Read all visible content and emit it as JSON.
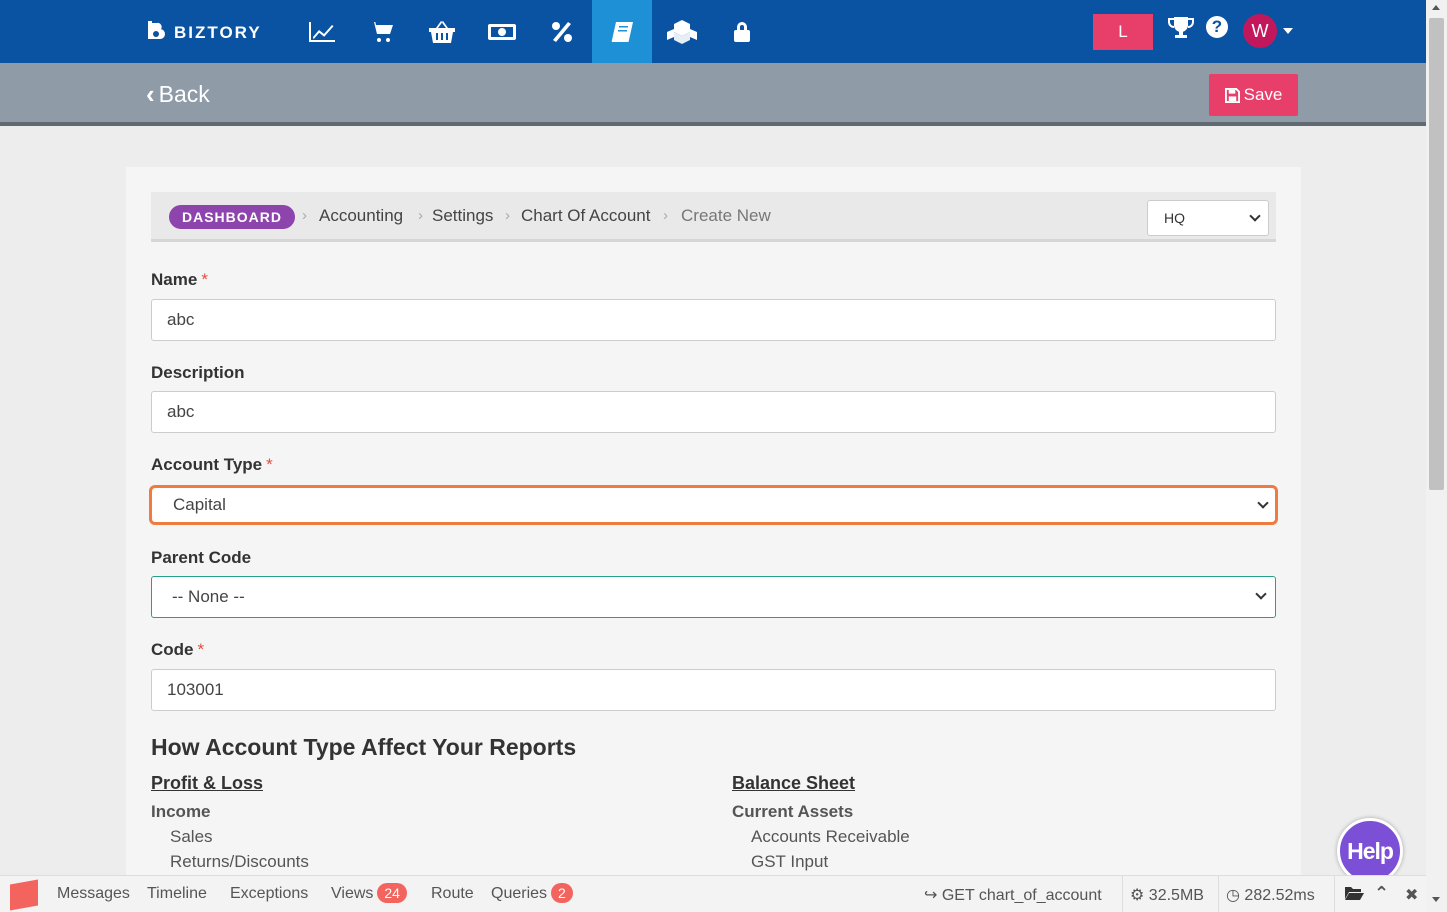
{
  "brand": {
    "name": "BIZTORY"
  },
  "topnav": {
    "icons": [
      "chart-line-icon",
      "cart-icon",
      "basket-icon",
      "money-icon",
      "percent-icon",
      "book-icon",
      "cubes-icon",
      "lock-icon"
    ],
    "active_index": 5,
    "l_button": "L",
    "avatar_initial": "W"
  },
  "subbar": {
    "back_label": "Back",
    "save_label": "Save"
  },
  "breadcrumb": {
    "dashboard": "DASHBOARD",
    "items": [
      "Accounting",
      "Settings",
      "Chart Of Account",
      "Create New"
    ],
    "branch_select": "HQ"
  },
  "form": {
    "name": {
      "label": "Name",
      "required": "*",
      "value": "abc"
    },
    "description": {
      "label": "Description",
      "value": "abc"
    },
    "account_type": {
      "label": "Account Type",
      "required": "*",
      "value": "Capital"
    },
    "parent_code": {
      "label": "Parent Code",
      "value": "-- None --"
    },
    "code": {
      "label": "Code",
      "required": "*",
      "value": "103001"
    }
  },
  "reports_info": {
    "title": "How Account Type Affect Your Reports",
    "profit_loss": {
      "title": "Profit & Loss",
      "group": "Income",
      "items": [
        "Sales",
        "Returns/Discounts"
      ]
    },
    "balance_sheet": {
      "title": "Balance Sheet",
      "group": "Current Assets",
      "items": [
        "Accounts Receivable",
        "GST Input"
      ]
    }
  },
  "help_bubble": "Help",
  "debugbar": {
    "tabs": [
      "Messages",
      "Timeline",
      "Exceptions",
      "Views",
      "Route",
      "Queries"
    ],
    "views_count": "24",
    "queries_count": "2",
    "request": "GET chart_of_account",
    "memory": "32.5MB",
    "time": "282.52ms"
  },
  "colors": {
    "navbar": "#0a53a2",
    "active_nav": "#1e91d6",
    "accent": "#e83e6a",
    "dashboard_badge": "#8e44ad",
    "focus_border": "#f07b3f"
  }
}
